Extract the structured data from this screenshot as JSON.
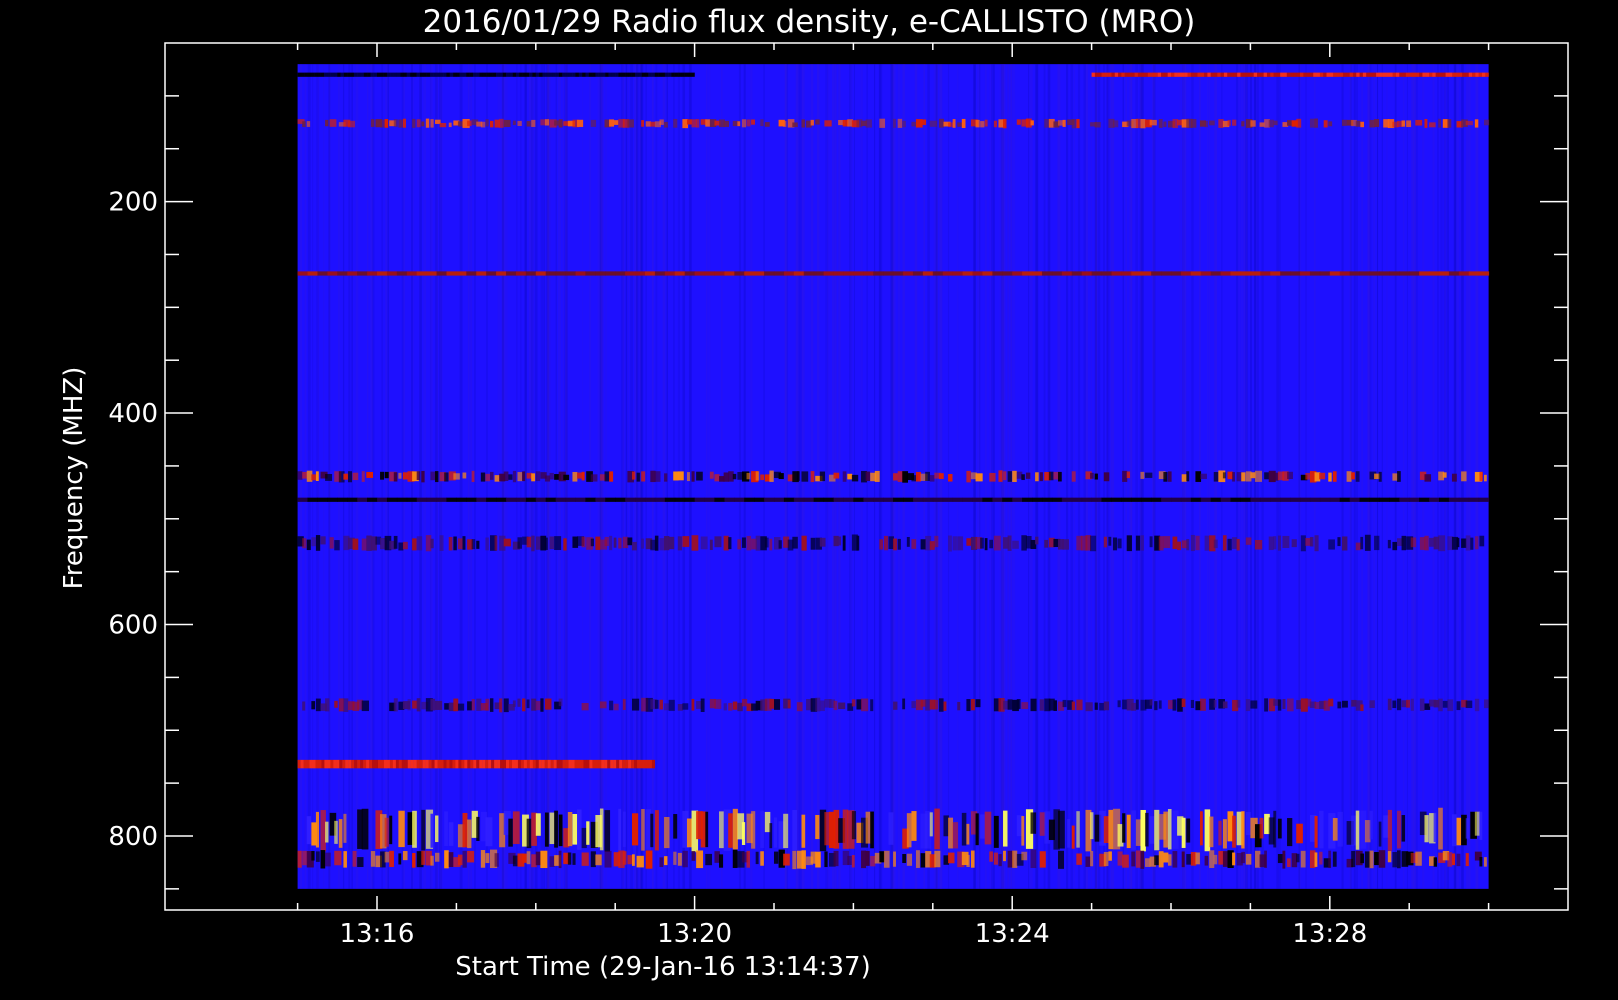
{
  "chart_data": {
    "type": "heatmap",
    "title": "2016/01/29  Radio flux density, e-CALLISTO (MRO)",
    "xlabel": "Start Time (29-Jan-16 13:14:37)",
    "ylabel": "Frequency (MHZ)",
    "x_axis": {
      "unit": "minutes after 13:00",
      "range": [
        13.33,
        31.0
      ],
      "data_range": [
        15.0,
        30.0
      ],
      "major_ticks": [
        16,
        20,
        24,
        28
      ],
      "tick_labels": [
        "13:16",
        "13:20",
        "13:24",
        "13:28"
      ],
      "minor_ticks": [
        15,
        17,
        18,
        19,
        21,
        22,
        23,
        25,
        26,
        27,
        29,
        30
      ]
    },
    "y_axis": {
      "unit": "MHz",
      "range": [
        50,
        870
      ],
      "inverted": true,
      "data_range": [
        70,
        850
      ],
      "major_ticks": [
        200,
        400,
        600,
        800
      ],
      "tick_labels": [
        "200",
        "400",
        "600",
        "800"
      ],
      "minor_ticks": [
        100,
        150,
        250,
        300,
        350,
        450,
        500,
        550,
        650,
        700,
        750,
        850
      ]
    },
    "colormap": [
      "#000000",
      "#1e10ff",
      "#e02000",
      "#ff8a10",
      "#ffff60"
    ],
    "background_level": "blue",
    "bands": [
      {
        "freq_start": 78,
        "freq_end": 82,
        "level": "black",
        "time_start": 15.0,
        "time_end": 20.0
      },
      {
        "freq_start": 78,
        "freq_end": 82,
        "level": "red",
        "time_start": 25.0,
        "time_end": 30.0
      },
      {
        "freq_start": 122,
        "freq_end": 130,
        "level": "red-speckle",
        "time_start": 15.0,
        "time_end": 30.0
      },
      {
        "freq_start": 266,
        "freq_end": 270,
        "level": "dark-red",
        "time_start": 15.0,
        "time_end": 30.0
      },
      {
        "freq_start": 455,
        "freq_end": 465,
        "level": "red-black-speckle",
        "time_start": 15.0,
        "time_end": 30.0
      },
      {
        "freq_start": 480,
        "freq_end": 484,
        "level": "dark-line",
        "time_start": 15.0,
        "time_end": 30.0
      },
      {
        "freq_start": 516,
        "freq_end": 530,
        "level": "dark-speckle",
        "time_start": 15.0,
        "time_end": 30.0
      },
      {
        "freq_start": 670,
        "freq_end": 682,
        "level": "dark-speckle",
        "time_start": 15.0,
        "time_end": 30.0
      },
      {
        "freq_start": 728,
        "freq_end": 736,
        "level": "red",
        "time_start": 15.0,
        "time_end": 19.5
      },
      {
        "freq_start": 776,
        "freq_end": 812,
        "level": "red-yellow-speckle",
        "time_start": 15.0,
        "time_end": 30.0
      },
      {
        "freq_start": 814,
        "freq_end": 830,
        "level": "red-black-speckle",
        "time_start": 15.0,
        "time_end": 30.0
      }
    ]
  }
}
